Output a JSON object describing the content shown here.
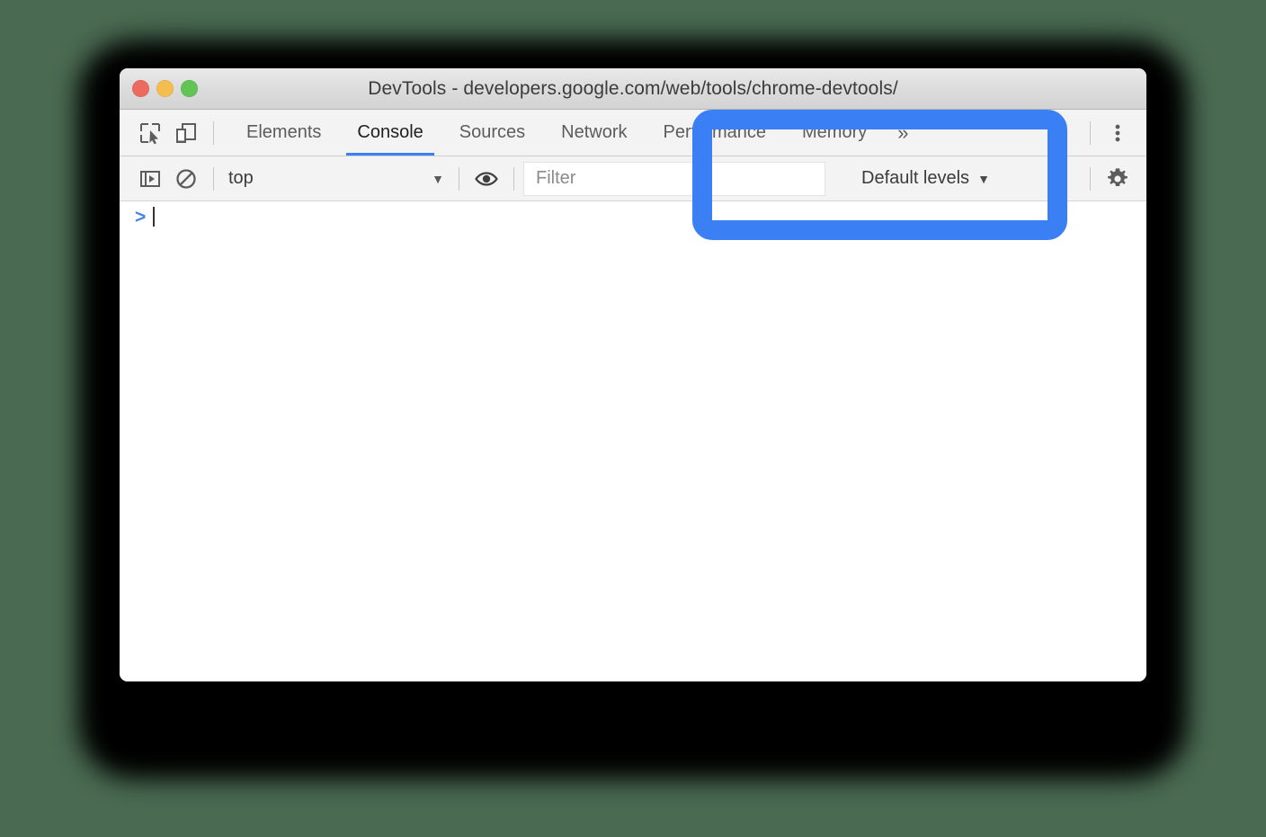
{
  "window": {
    "title": "DevTools - developers.google.com/web/tools/chrome-devtools/",
    "traffic_lights": {
      "close_color": "#ec6a5e",
      "minimize_color": "#f4bd4f",
      "maximize_color": "#61c454"
    }
  },
  "tabbar": {
    "inspect_icon": "inspect-element-icon",
    "device_icon": "device-toolbar-icon",
    "tabs": [
      {
        "label": "Elements",
        "active": false
      },
      {
        "label": "Console",
        "active": true
      },
      {
        "label": "Sources",
        "active": false
      },
      {
        "label": "Network",
        "active": false
      },
      {
        "label": "Performance",
        "active": false
      },
      {
        "label": "Memory",
        "active": false
      }
    ],
    "overflow_label": "»",
    "more_icon": "more-vertical-icon"
  },
  "filterbar": {
    "sidebar_toggle_icon": "console-sidebar-icon",
    "clear_icon": "clear-console-icon",
    "context": {
      "value": "top",
      "caret": "▼"
    },
    "eye_icon": "live-expression-eye-icon",
    "filter": {
      "value": "",
      "placeholder": "Filter"
    },
    "levels": {
      "value": "Default levels",
      "caret": "▼"
    },
    "settings_icon": "settings-gear-icon"
  },
  "console": {
    "prompt_symbol": ">",
    "input_value": ""
  },
  "annotation": {
    "highlight_color": "#3b7ff5",
    "target": "Default levels dropdown"
  },
  "colors": {
    "background": "#4a6a52",
    "accent_blue": "#3b7ff5",
    "toolbar_bg": "#f3f3f3",
    "active_tab_text": "#1f1f1f",
    "inactive_tab_text": "#5c5c5c"
  }
}
